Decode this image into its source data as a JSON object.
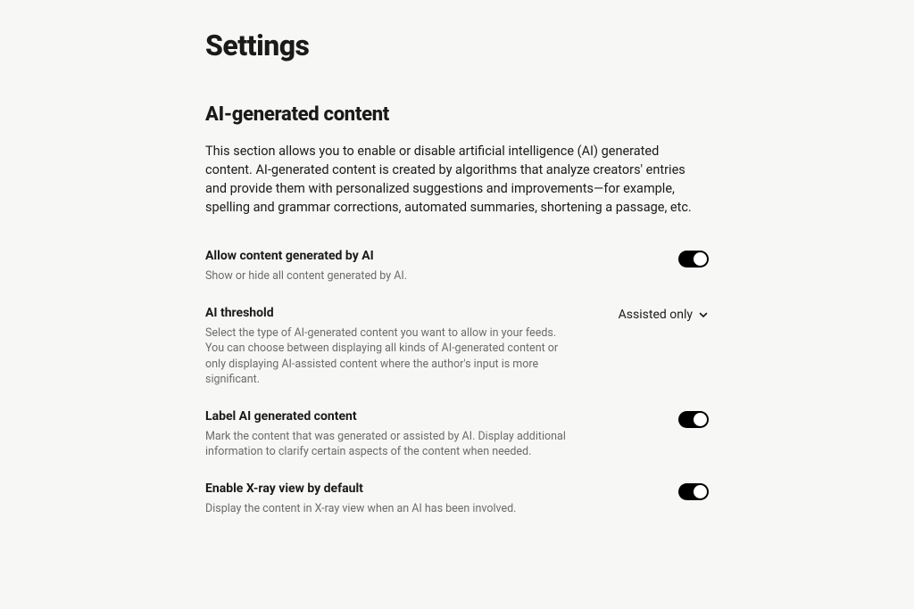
{
  "page": {
    "title": "Settings"
  },
  "section": {
    "heading": "AI-generated content",
    "description": "This section allows you to enable or disable artificial intelligence (AI) generated content. AI-generated content is created by algorithms that analyze creators' entries and provide them with personalized suggestions and improvements—for example, spelling and grammar corrections, automated summaries, shortening a passage, etc."
  },
  "options": {
    "allow": {
      "title": "Allow content generated by AI",
      "desc": "Show or hide all content generated by AI.",
      "value": true
    },
    "threshold": {
      "title": "AI threshold",
      "desc": "Select the type of AI-generated content you want to allow in your feeds. You can choose between displaying all kinds of AI-generated content or only displaying AI-assisted content where the author's input is more significant.",
      "selected": "Assisted only"
    },
    "label": {
      "title": "Label AI generated content",
      "desc": "Mark the content that was generated or assisted by AI. Display additional information to clarify certain aspects of the content when needed.",
      "value": true
    },
    "xray": {
      "title": "Enable X-ray view by default",
      "desc": "Display the content in X-ray view when an AI has been involved.",
      "value": true
    }
  }
}
